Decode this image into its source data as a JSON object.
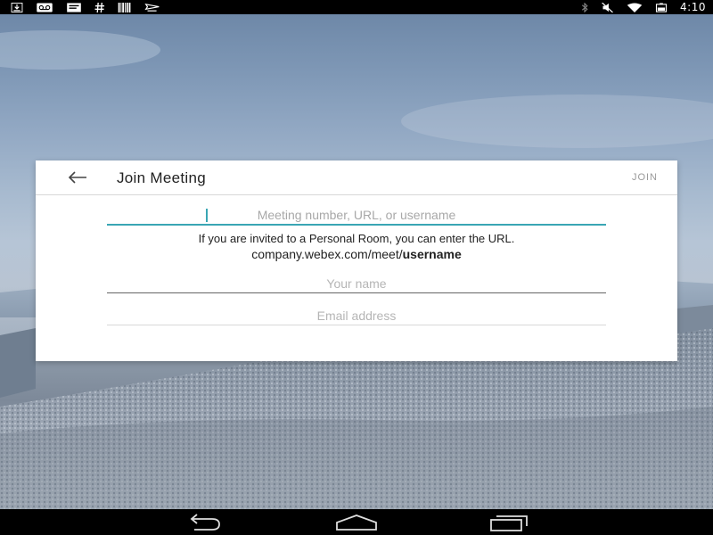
{
  "status_bar": {
    "time": "4:10",
    "left_icons": [
      "download-icon",
      "voicemail-icon",
      "message-icon",
      "hashtag-icon",
      "barcode-icon",
      "plane-icon"
    ],
    "right_icons": [
      "bluetooth-icon",
      "mute-icon",
      "wifi-icon",
      "battery-icon"
    ]
  },
  "dialog": {
    "title": "Join Meeting",
    "join_label": "JOIN",
    "meeting_placeholder": "Meeting number, URL, or username",
    "hint_line_1": "If you are invited to a Personal Room, you can enter the URL.",
    "hint_url_prefix": "company.webex.com/meet/",
    "hint_url_bold": "username",
    "name_placeholder": "Your name",
    "email_placeholder": "Email address"
  },
  "nav_bar": {
    "buttons": [
      "back-nav",
      "home-nav",
      "recent-apps-nav"
    ]
  },
  "colors": {
    "accent": "#3aa6b4",
    "status_bar": "#000000",
    "dialog_bg": "#ffffff"
  }
}
